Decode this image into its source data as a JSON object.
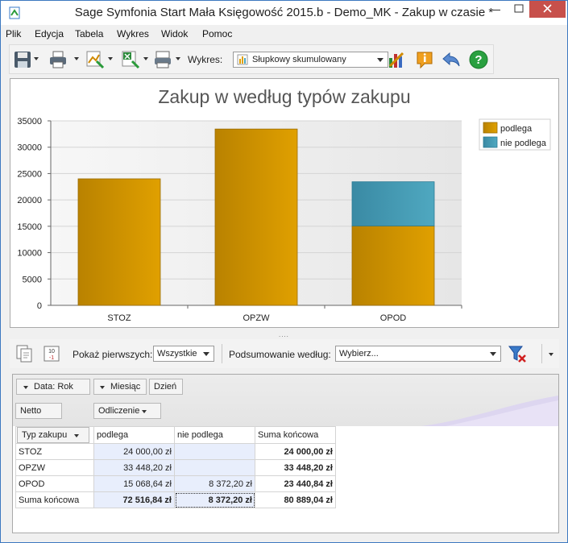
{
  "window": {
    "title": "Sage Symfonia Start Mała Księgowość 2015.b - Demo_MK - Zakup w czasie *"
  },
  "menu": [
    "Plik",
    "Edycja",
    "Tabela",
    "Wykres",
    "Widok",
    "Pomoc"
  ],
  "toolbar": {
    "chart_label": "Wykres:",
    "chart_type_value": "Słupkowy skumulowany"
  },
  "colors": {
    "podlega": "#e0a000",
    "nie_podlega": "#4fa8c0"
  },
  "chart_data": {
    "type": "bar",
    "stacked": true,
    "title": "Zakup w według typów zakupu",
    "categories": [
      "STOZ",
      "OPZW",
      "OPOD"
    ],
    "series": [
      {
        "name": "podlega",
        "values": [
          24000.0,
          33448.2,
          15068.64
        ]
      },
      {
        "name": "nie podlega",
        "values": [
          0,
          0,
          8372.2
        ]
      }
    ],
    "yticks": [
      "0",
      "5000",
      "10000",
      "15000",
      "20000",
      "25000",
      "30000",
      "35000"
    ],
    "ylim": [
      0,
      35000
    ],
    "grid": true,
    "legend": "top-right"
  },
  "pivot_toolbar": {
    "show_first_label": "Pokaż pierwszych:",
    "show_first_value": "Wszystkie",
    "summary_label": "Podsumowanie według:",
    "summary_value": "Wybierz..."
  },
  "pivot": {
    "date_field": "Data: Rok",
    "month_field": "Miesiąc",
    "day_field": "Dzień",
    "netto": "Netto",
    "data_field": "Odliczenie",
    "row_field": "Typ zakupu",
    "columns": [
      "podlega",
      "nie podlega",
      "Suma końcowa"
    ],
    "rows": [
      {
        "label": "STOZ",
        "podlega": "24 000,00 zł",
        "nie_podlega": "",
        "total": "24 000,00 zł"
      },
      {
        "label": "OPZW",
        "podlega": "33 448,20 zł",
        "nie_podlega": "",
        "total": "33 448,20 zł"
      },
      {
        "label": "OPOD",
        "podlega": "15 068,64 zł",
        "nie_podlega": "8 372,20 zł",
        "total": "23 440,84 zł"
      }
    ],
    "grand_total": {
      "label": "Suma końcowa",
      "podlega": "72 516,84 zł",
      "nie_podlega": "8 372,20 zł",
      "total": "80 889,04 zł"
    }
  }
}
